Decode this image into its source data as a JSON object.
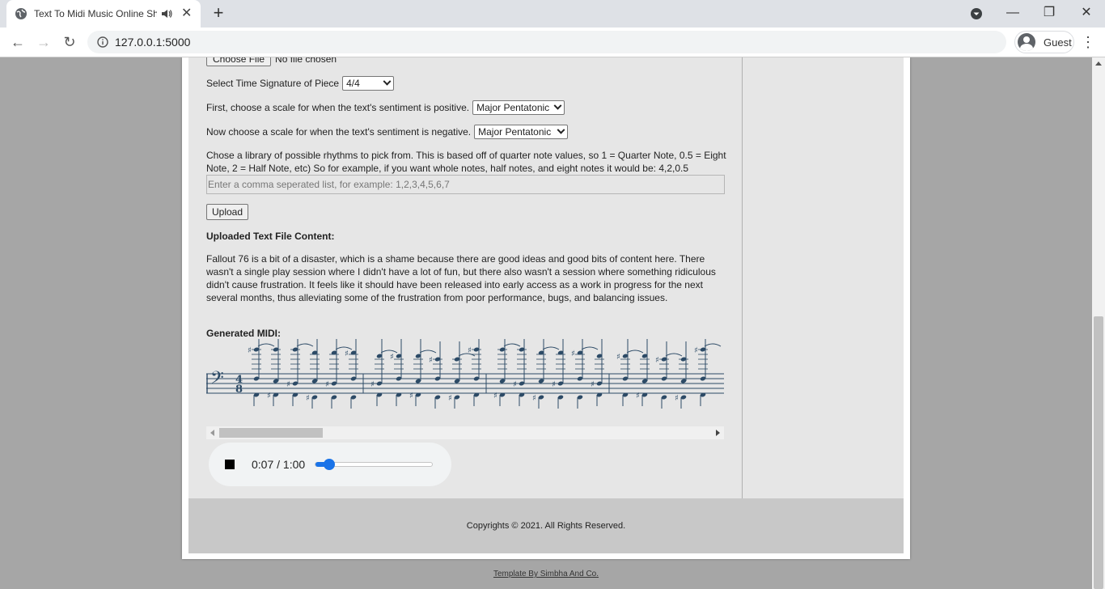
{
  "browser": {
    "tab_title": "Text To Midi Music Online Sheets",
    "url": "127.0.0.1:5000",
    "profile_label": "Guest",
    "new_tab_symbol": "+",
    "tab_close_symbol": "✕",
    "window_controls": {
      "minimize": "—",
      "restore": "❐",
      "close": "✕"
    },
    "back_symbol": "←",
    "forward_symbol": "→",
    "reload_symbol": "↻",
    "menu_symbol": "⋮"
  },
  "form": {
    "file_button": "Choose File",
    "file_status": "No file chosen",
    "time_signature_label": "Select Time Signature of Piece",
    "time_signature_value": "4/4",
    "positive_scale_label": "First, choose a scale for when the text's sentiment is positive.",
    "positive_scale_value": "Major Pentatonic",
    "negative_scale_label": "Now choose a scale for when the text's sentiment is negative.",
    "negative_scale_value": "Major Pentatonic",
    "rhythm_text": "Chose a library of possible rhythms to pick from. This is based off of quarter note values, so 1 = Quarter Note, 0.5 = Eight Note, 2 = Half Note, etc) So for example, if you want whole notes, half notes, and eight notes it would be: 4,2,0.5",
    "rhythm_placeholder": "Enter a comma seperated list, for example: 1,2,3,4,5,6,7",
    "upload_button": "Upload"
  },
  "content": {
    "uploaded_heading": "Uploaded Text File Content:",
    "paragraph": "Fallout 76 is a bit of a disaster, which is a shame because there are good ideas and good bits of content here. There wasn't a single play session where I didn't have a lot of fun, but there also wasn't a session where something ridiculous didn't cause frustration. It feels like it should have been released into early access as a work in progress for the next several months, thus alleviating some of the frustration from poor performance, bugs, and balancing issues.",
    "midi_heading": "Generated MIDI:"
  },
  "score": {
    "time_signature_top": "4",
    "time_signature_bottom": "8",
    "clef": "bass",
    "sharp_symbol": "♯",
    "note_color": "#2c4a66"
  },
  "player": {
    "time": "0:07 / 1:00",
    "progress": 0.117
  },
  "footer": {
    "copyright": "Copyrights © 2021. All Rights Reserved.",
    "credit": "Template By Simbha And Co."
  }
}
